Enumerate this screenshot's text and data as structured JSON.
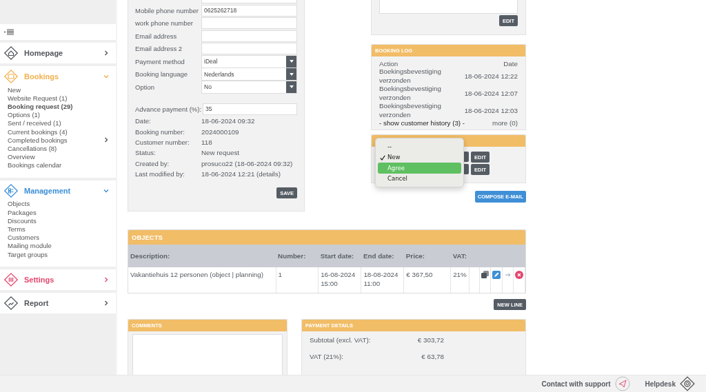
{
  "sidebar": {
    "sections": [
      {
        "label": "Homepage",
        "color": "#50555b",
        "expanded": false
      },
      {
        "label": "Bookings",
        "color": "#f2b04f",
        "expanded": true,
        "items": [
          {
            "label": "New",
            "selected": false,
            "submenu": false
          },
          {
            "label": "Website Request (1)",
            "selected": false,
            "submenu": false
          },
          {
            "label": "Booking request (29)",
            "selected": true,
            "submenu": false
          },
          {
            "label": "Options (1)",
            "selected": false,
            "submenu": false
          },
          {
            "label": "Sent / received (1)",
            "selected": false,
            "submenu": false
          },
          {
            "label": "Current bookings (4)",
            "selected": false,
            "submenu": false
          },
          {
            "label": "Completed bookings",
            "selected": false,
            "submenu": true
          },
          {
            "label": "Cancellations (8)",
            "selected": false,
            "submenu": false
          },
          {
            "label": "Overview",
            "selected": false,
            "submenu": false
          },
          {
            "label": "Bookings calendar",
            "selected": false,
            "submenu": false
          }
        ]
      },
      {
        "label": "Management",
        "color": "#3b8ed8",
        "expanded": true,
        "items": [
          {
            "label": "Objects",
            "selected": false,
            "submenu": false
          },
          {
            "label": "Packages",
            "selected": false,
            "submenu": false
          },
          {
            "label": "Discounts",
            "selected": false,
            "submenu": false
          },
          {
            "label": "Terms",
            "selected": false,
            "submenu": false
          },
          {
            "label": "Customers",
            "selected": false,
            "submenu": false
          },
          {
            "label": "Mailing module",
            "selected": false,
            "submenu": false
          },
          {
            "label": "Target groups",
            "selected": false,
            "submenu": false
          }
        ]
      },
      {
        "label": "Settings",
        "color": "#e5476e",
        "expanded": false
      },
      {
        "label": "Report",
        "color": "#50555b",
        "expanded": false
      }
    ]
  },
  "form": {
    "fields": [
      {
        "label": "Mobile phone number",
        "kind": "text",
        "value": "0625262718"
      },
      {
        "label": "work phone number",
        "kind": "text"
      },
      {
        "label": "Email address",
        "kind": "text"
      },
      {
        "label": "Email address 2",
        "kind": "text"
      },
      {
        "label": "Payment method",
        "kind": "select",
        "value": "iDeal"
      },
      {
        "label": "Booking language",
        "kind": "select",
        "value": "Nederlands"
      },
      {
        "label": "Option",
        "kind": "select",
        "value": "No"
      }
    ],
    "advance": {
      "label": "Advance payment (%):",
      "value": "35"
    },
    "info": [
      {
        "label": "Date:",
        "value": "18-06-2024 09:32"
      },
      {
        "label": "Booking number:",
        "value": "2024000109"
      },
      {
        "label": "Customer number:",
        "value": "118"
      },
      {
        "label": "Status:",
        "value": "New request"
      },
      {
        "label": "Created by:",
        "value": "prosuco22 (18-06-2024 09:32)"
      },
      {
        "label": "Last modified by:",
        "value": "18-06-2024 12:21 (details)"
      }
    ],
    "save": "SAVE"
  },
  "notes_panel": {
    "edit": "EDIT"
  },
  "booking_log": {
    "title": "BOOKING LOG",
    "columns": [
      "Action",
      "Date"
    ],
    "rows": [
      {
        "action": "Boekingsbevestiging verzonden",
        "date": "18-06-2024 12:22"
      },
      {
        "action": "Boekingsbevestiging verzonden",
        "date": "18-06-2024 12:07"
      },
      {
        "action": "Boekingsbevestiging verzonden",
        "date": "18-06-2024 12:03"
      }
    ],
    "history_link": "- show customer history (3) -",
    "more_link": "more (0)"
  },
  "status_panel": {
    "edit_buttons": [
      "EDIT",
      "EDIT"
    ],
    "dropdown": {
      "options": [
        {
          "label": "--",
          "checked": false,
          "highlighted": false
        },
        {
          "label": "New",
          "checked": true,
          "highlighted": false
        },
        {
          "label": "Agree",
          "checked": false,
          "highlighted": true
        },
        {
          "label": "Cancel",
          "checked": false,
          "highlighted": false
        }
      ]
    }
  },
  "compose": "COMPOSE E-MAIL",
  "objects": {
    "title": "OBJECTS",
    "columns": [
      "Description:",
      "Number:",
      "Start date:",
      "End date:",
      "Price:",
      "VAT:"
    ],
    "rows": [
      {
        "description": "Vakantiehuis 12 personen (object | planning)",
        "number": "1",
        "start": "16-08-2024 15:00",
        "end": "18-08-2024 11:00",
        "price": "€ 367,50",
        "vat": "21%"
      }
    ],
    "new_line": "NEW LINE"
  },
  "comments": {
    "title": "COMMENTS"
  },
  "payment": {
    "title": "PAYMENT DETAILS",
    "rows": [
      {
        "label": "Subtotal (excl. VAT):",
        "value": "€ 303,72"
      },
      {
        "label": "VAT (21%):",
        "value": "€ 63,78"
      }
    ]
  },
  "footer": {
    "support": "Contact with support",
    "helpdesk": "Helpdesk"
  }
}
